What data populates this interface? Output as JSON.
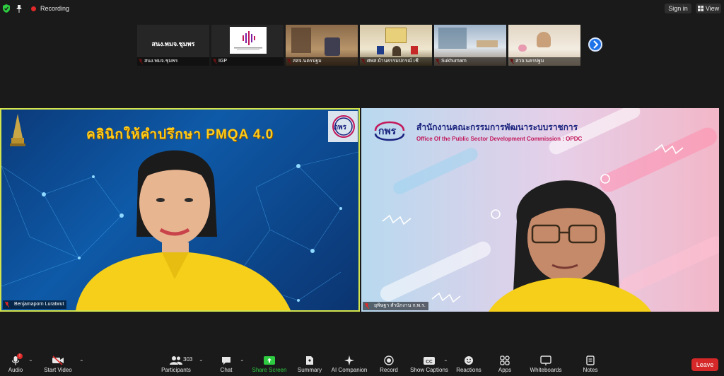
{
  "topbar": {
    "shield_icon": "shield-check-icon",
    "pin_icon": "pin-icon",
    "recording_label": "Recording",
    "signin_label": "Sign in",
    "view_label": "View"
  },
  "gallery": [
    {
      "label": "สนง.พมจ.ชุมพร",
      "center_text": "สนง.พมจ.ชุมพร"
    },
    {
      "label": "IGP"
    },
    {
      "label": "สสจ.นครปฐม"
    },
    {
      "label": "ศพส.บ้านธรรมปกรณ์ เชี"
    },
    {
      "label": "Sukhumarn"
    },
    {
      "label": "สวจ.นครปฐม"
    }
  ],
  "left_tile": {
    "banner": "คลินิกให้คำปรึกษา PMQA 4.0",
    "logo": "กพร",
    "name": "Benjamaporn Luratwut"
  },
  "right_tile": {
    "logo": "กพร",
    "org_th": "สำนักงานคณะกรรมการพัฒนาระบบราชการ",
    "org_en": "Office Of the Public Sector Development Commission : OPDC",
    "name": "ยุพิษฐา สำนักงาน ก.พ.ร."
  },
  "toolbar": {
    "audio": "Audio",
    "audio_badge": "!",
    "start_video": "Start Video",
    "participants": "Participants",
    "participants_count": "303",
    "chat": "Chat",
    "share_screen": "Share Screen",
    "summary": "Summary",
    "ai_companion": "AI Companion",
    "record": "Record",
    "show_captions": "Show Captions",
    "reactions": "Reactions",
    "apps": "Apps",
    "whiteboards": "Whiteboards",
    "notes": "Notes",
    "leave": "Leave"
  },
  "colors": {
    "accent_green": "#2ecc40",
    "leave_red": "#d62828",
    "active_speaker_border": "#d4e44a",
    "scroll_blue": "#1e73e8"
  }
}
